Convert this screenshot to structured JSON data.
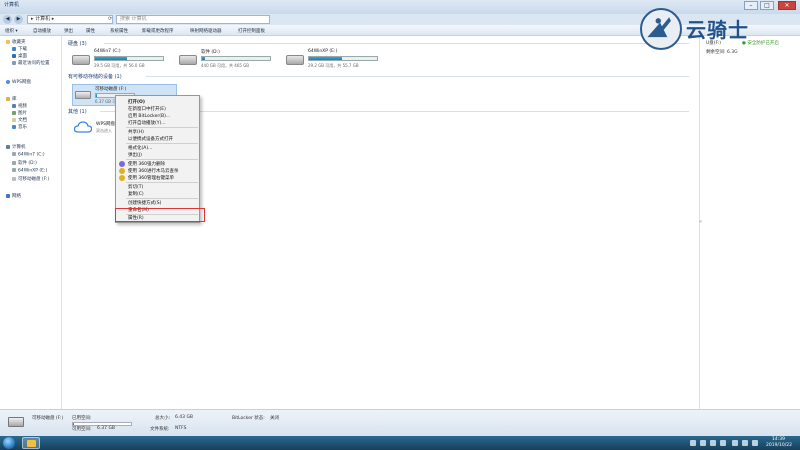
{
  "window": {
    "title": "计算机"
  },
  "address": {
    "path": "▸ 计算机 ▸",
    "search_placeholder": "搜索 计算机"
  },
  "toolbar": {
    "items": [
      "组织 ▾",
      "自动播放",
      "弹出",
      "属性",
      "系统属性",
      "卸载或更改程序",
      "映射网络驱动器",
      "打开控制面板"
    ]
  },
  "sidebar": {
    "favorites": [
      "收藏夹",
      "下载",
      "桌面",
      "最近访问的位置"
    ],
    "wps": "WPS网盘",
    "libraries": [
      "库",
      "视频",
      "图片",
      "文档",
      "音乐"
    ],
    "computer": [
      "计算机",
      "64Win7 (C:)",
      "软件 (D:)",
      "64WinXP (E:)",
      "可移动磁盘 (F:)"
    ],
    "network": "网络"
  },
  "main": {
    "hard_drives_header": "硬盘 (3)",
    "removable_header": "有可移动存储的设备 (1)",
    "other_header": "其他 (1)",
    "drives": [
      {
        "name": "64Win7 (C:)",
        "free": "29.5 GB 可用，共 56.0 GB",
        "used_percent": 47
      },
      {
        "name": "软件 (D:)",
        "free": "440 GB 可用，共 465 GB",
        "used_percent": 5
      },
      {
        "name": "64WinXP (E:)",
        "free": "29.2 GB 可用，共 55.7 GB",
        "used_percent": 48
      }
    ],
    "usb": {
      "name": "可移动磁盘 (F:)",
      "free": "6.37 GB 可",
      "used_percent": 3
    },
    "wps": {
      "name": "WPS网盘",
      "desc": "双击进入"
    }
  },
  "context_menu": {
    "items": [
      {
        "label": "打开(O)",
        "bold": true
      },
      {
        "label": "在新窗口中打开(E)"
      },
      {
        "label": "启用 BitLocker(B)..."
      },
      {
        "label": "打开自动播放(Y)..."
      },
      {
        "label": "共享(H)"
      },
      {
        "label": "以便携式设备方式打开"
      },
      {
        "label": "格式化(A)..."
      },
      {
        "label": "弹出(J)"
      },
      {
        "label": "使用 360强力删除"
      },
      {
        "label": "使用 360进行木马云查杀"
      },
      {
        "label": "使用 360管理右键菜单"
      },
      {
        "label": "剪切(T)"
      },
      {
        "label": "复制(C)"
      },
      {
        "label": "创建快捷方式(S)"
      },
      {
        "label": "重命名(M)"
      },
      {
        "label": "属性(R)"
      }
    ]
  },
  "right_pane": {
    "drive": "U盘(F:)",
    "protect": "安全防护已开启",
    "free_label": "剩余空间: 6.3G"
  },
  "status": {
    "name": "可移动磁盘 (F:)",
    "used_label": "已用空间:",
    "free_label": "可用空间:",
    "free_value": "6.37 GB",
    "total_label": "总大小:",
    "total_value": "6.43 GB",
    "fs_label": "文件系统:",
    "fs_value": "NTFS",
    "bitlocker_label": "BitLocker 状态:",
    "bitlocker_value": "关闭",
    "used_percent": 1
  },
  "taskbar": {
    "time": "14:39",
    "date": "2019/10/22"
  },
  "watermark": {
    "text": "云骑士"
  },
  "colors": {
    "accent": "#1a7fb5",
    "highlight_box": "#e13434",
    "taskbar": "#173f5c"
  }
}
